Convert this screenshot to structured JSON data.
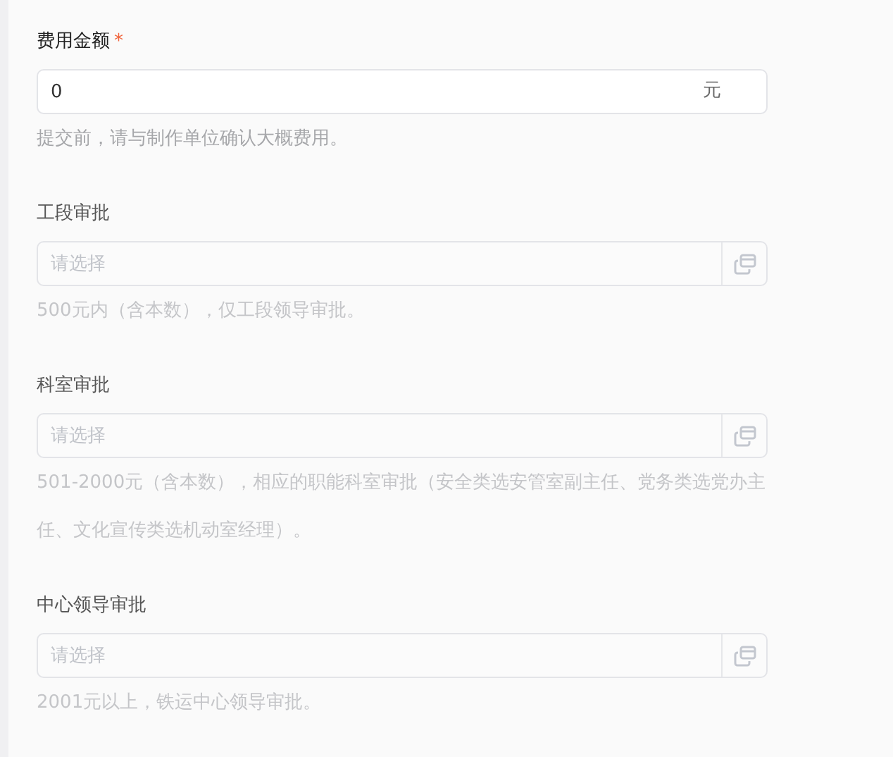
{
  "fields": [
    {
      "kind": "amount",
      "label": "费用金额",
      "required_mark": "*",
      "value": "0",
      "unit": "元",
      "hint": "提交前，请与制作单位确认大概费用。"
    },
    {
      "kind": "select",
      "label": "工段审批",
      "placeholder": "请选择",
      "hint": "500元内（含本数），仅工段领导审批。",
      "disabled": true
    },
    {
      "kind": "select",
      "label": "科室审批",
      "placeholder": "请选择",
      "hint": "501-2000元（含本数），相应的职能科室审批（安全类选安管室副主任、党务类选党办主任、文化宣传类选机动室经理）。",
      "disabled": true
    },
    {
      "kind": "select",
      "label": "中心领导审批",
      "placeholder": "请选择",
      "hint": "2001元以上，铁运中心领导审批。",
      "disabled": true
    }
  ]
}
